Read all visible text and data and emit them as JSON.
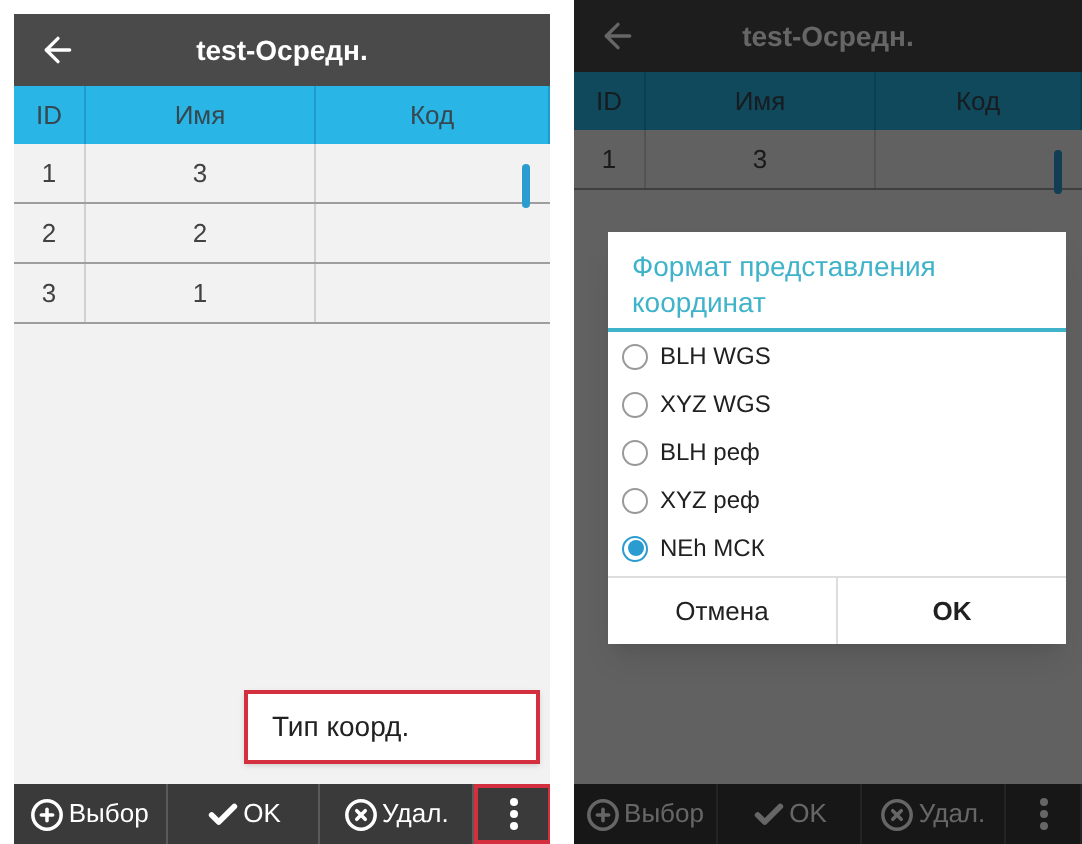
{
  "screens": [
    {
      "dimmed": false,
      "header": {
        "title": "test-Осредн."
      },
      "table": {
        "columns": [
          "ID",
          "Имя",
          "Код"
        ],
        "rows": [
          {
            "id": "1",
            "name": "3"
          },
          {
            "id": "2",
            "name": "2"
          },
          {
            "id": "3",
            "name": "1"
          }
        ]
      },
      "popup_menu": {
        "items": [
          {
            "label": "Тип коорд.",
            "highlighted": true
          }
        ]
      },
      "toolbar": [
        {
          "kind": "add",
          "label": "Выбор",
          "highlighted": false
        },
        {
          "kind": "confirm",
          "label": "OK",
          "highlighted": false
        },
        {
          "kind": "delete",
          "label": "Удал.",
          "highlighted": false
        },
        {
          "kind": "more",
          "highlighted": true
        }
      ]
    },
    {
      "dimmed": true,
      "header": {
        "title": "test-Осредн."
      },
      "table": {
        "columns": [
          "ID",
          "Имя",
          "Код"
        ],
        "rows": [
          {
            "id": "1",
            "name": "3"
          }
        ]
      },
      "dialog": {
        "title": "Формат представления координат",
        "options": [
          {
            "label": "BLH WGS",
            "selected": false
          },
          {
            "label": "XYZ WGS",
            "selected": false
          },
          {
            "label": "BLH реф",
            "selected": false
          },
          {
            "label": "XYZ реф",
            "selected": false
          },
          {
            "label": "NEh МСК",
            "selected": true
          }
        ],
        "buttons": [
          "Отмена",
          "OK"
        ]
      },
      "toolbar": [
        {
          "kind": "add",
          "label": "Выбор",
          "highlighted": false
        },
        {
          "kind": "confirm",
          "label": "OK",
          "highlighted": false
        },
        {
          "kind": "delete",
          "label": "Удал.",
          "highlighted": false
        },
        {
          "kind": "more",
          "highlighted": false
        }
      ]
    }
  ]
}
